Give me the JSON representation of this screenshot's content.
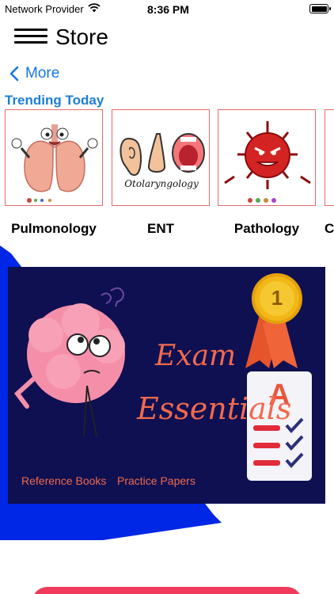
{
  "status_bar": {
    "carrier": "Network Provider",
    "time": "8:36 PM",
    "wifi_icon": "wifi-icon",
    "battery_icon": "battery-icon"
  },
  "header": {
    "title": "Store",
    "menu_icon": "hamburger-menu-icon"
  },
  "nav": {
    "back_label": "More"
  },
  "trending": {
    "title": "Trending Today",
    "items": [
      {
        "label": "Pulmonology",
        "image": "lungs-illustration"
      },
      {
        "label": "ENT",
        "image": "ear-nose-throat-illustration",
        "caption": "Otolaryngology"
      },
      {
        "label": "Pathology",
        "image": "virus-illustration"
      },
      {
        "label": "C",
        "image": "partial-card"
      }
    ]
  },
  "banner": {
    "line1": "Exam",
    "line2": "Essentials",
    "badge_number": "1",
    "grade_letter": "A",
    "link_left": "Reference Books",
    "link_right": "Practice Papers"
  },
  "colors": {
    "accent_blue": "#1677e6",
    "banner_bg": "#0f1052",
    "banner_text": "#f16a4c",
    "card_border": "#e46b6b",
    "bottom_button": "#ef3a5b"
  }
}
